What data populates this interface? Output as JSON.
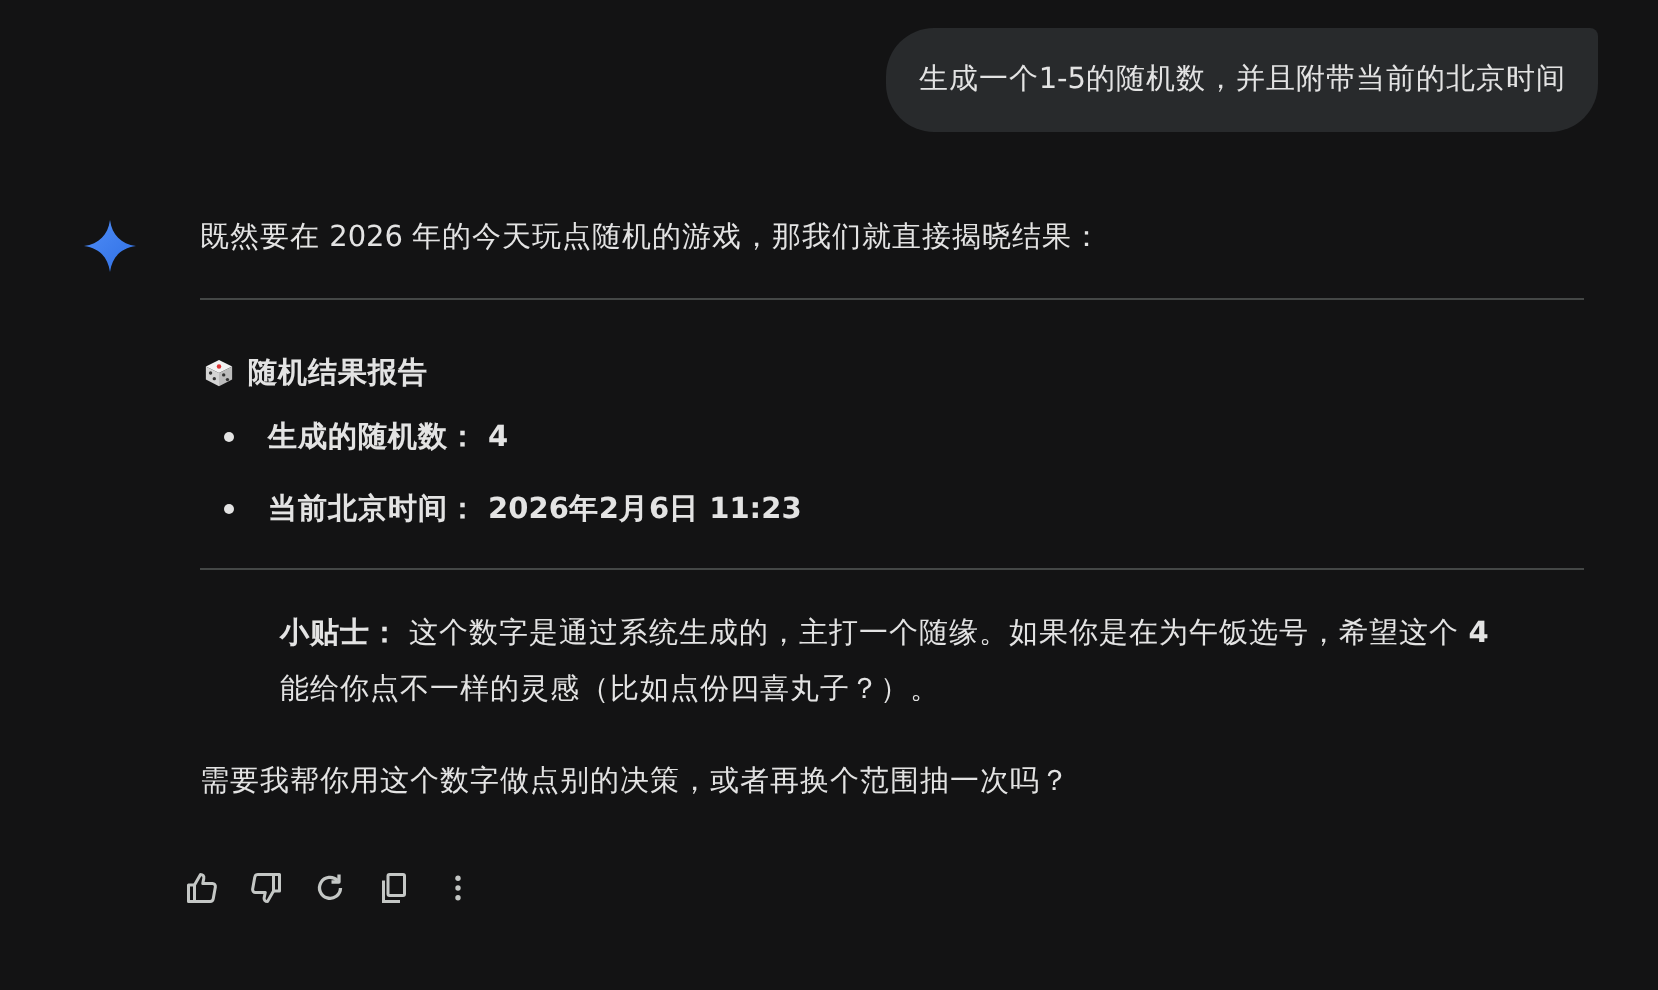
{
  "user_message": "生成一个1-5的随机数，并且附带当前的北京时间",
  "response": {
    "intro": "既然要在 2026 年的今天玩点随机的游戏，那我们就直接揭晓结果：",
    "heading": "随机结果报告",
    "bullets": [
      "生成的随机数： 4",
      "当前北京时间： 2026年2月6日 11:23"
    ],
    "tip": "**小贴士：** 这个数字是通过系统生成的，主打一个随缘。如果你是在为午饭选号，希望这个 **4** 能给你点不一样的灵感（比如点份四喜丸子？）。",
    "closing": "需要我帮你用这个数字做点别的决策，或者再换个范围抽一次吗？"
  }
}
